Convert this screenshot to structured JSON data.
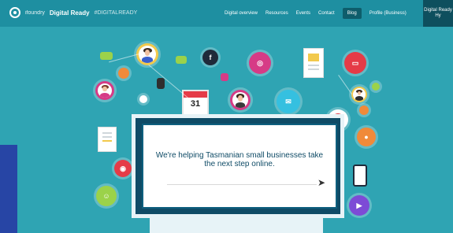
{
  "nav": {
    "brand_small": "ifoundry",
    "brand_title": "Digital Ready",
    "brand_sub": "#DIGITALREADY",
    "items": [
      "Digital overview",
      "Resources",
      "Events",
      "Contact",
      "Blog",
      "Profile (Business)"
    ],
    "cta": "Digital Ready Hy"
  },
  "hero": {
    "headline": "We're helping Tasmanian small businesses take the next step online.",
    "arrow": "➤"
  },
  "calendar": {
    "day": "31"
  },
  "colors": {
    "background": "#2fa4b3",
    "navbar": "#1e8fa1",
    "monitor": "#0f4b66",
    "accent_red": "#e53b47",
    "accent_pink": "#d63b86",
    "accent_green": "#9bd24a",
    "accent_orange": "#f08a3a"
  },
  "icons": [
    "facebook-icon",
    "instagram-icon",
    "youtube-icon",
    "calendar-icon",
    "tablet-icon",
    "document-icon",
    "chat-icon",
    "user-avatar-icon"
  ]
}
